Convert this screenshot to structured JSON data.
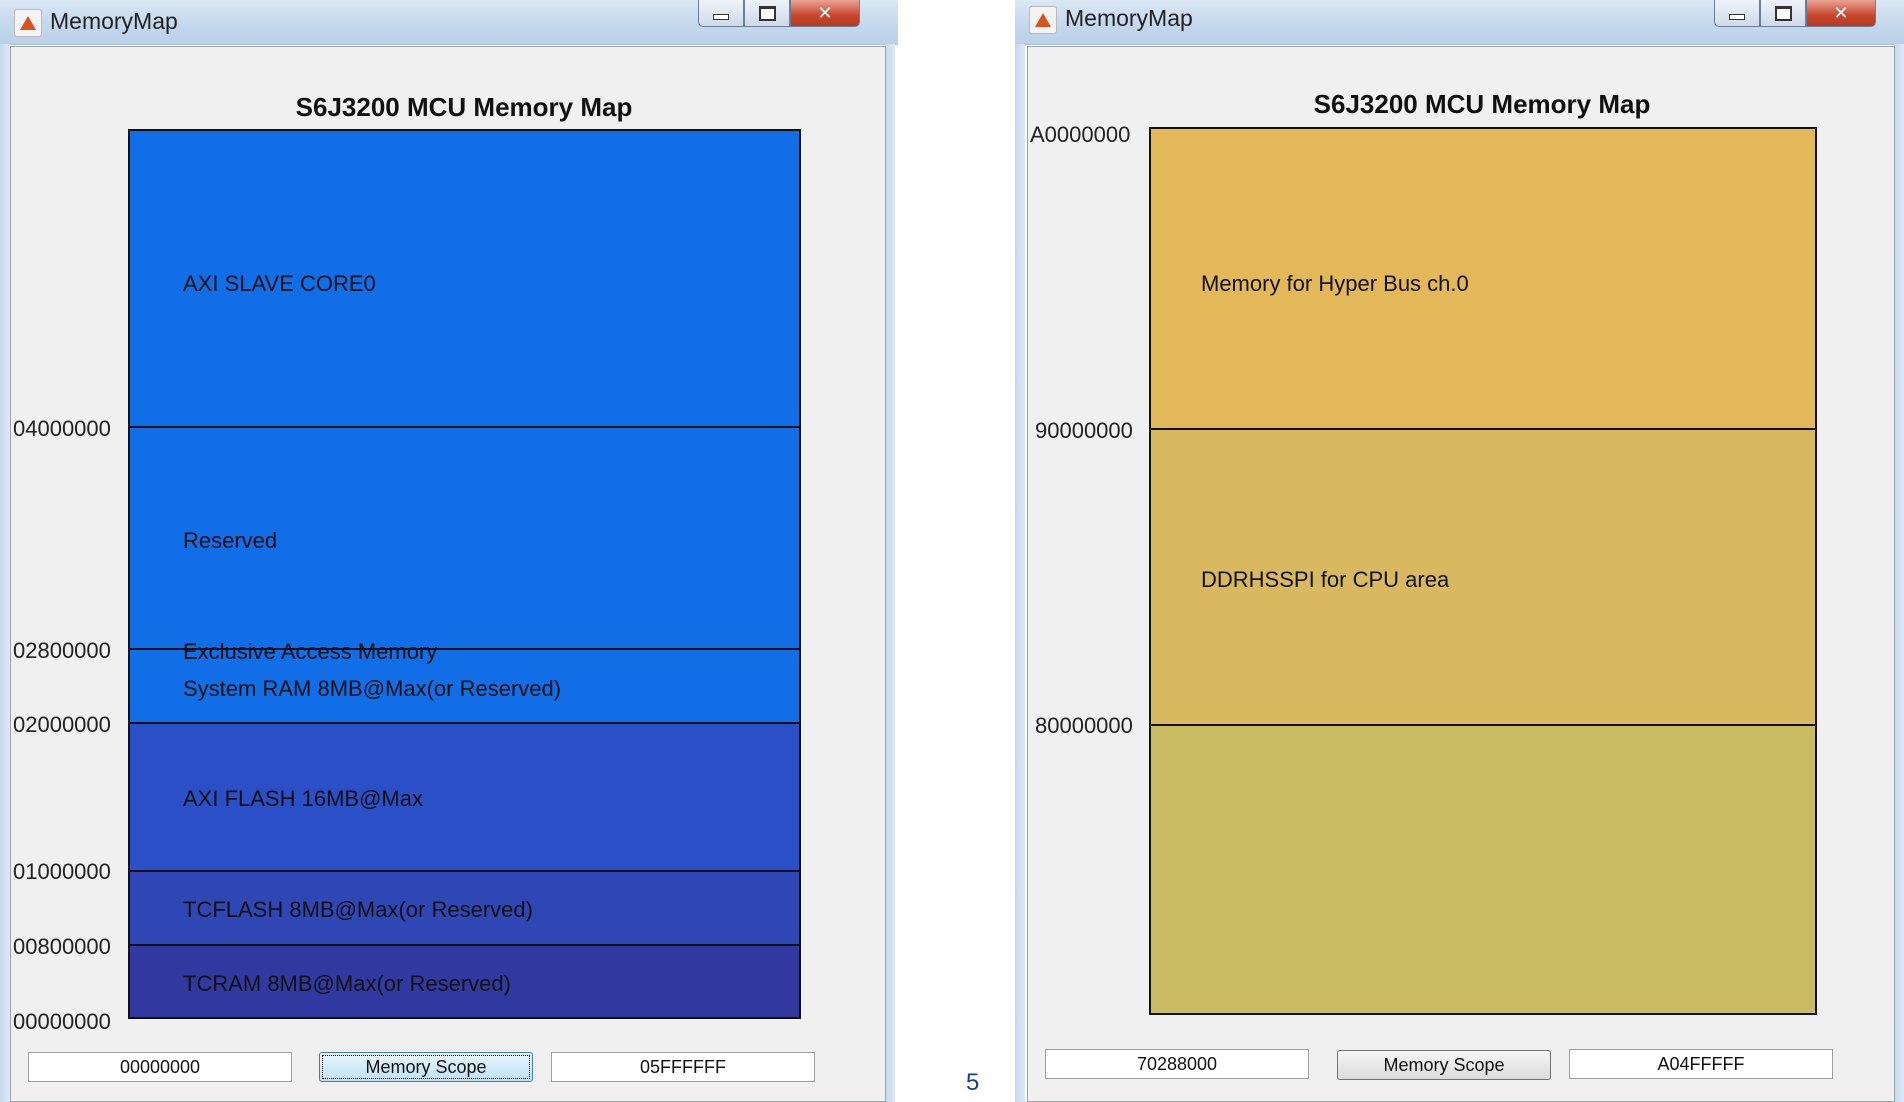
{
  "windows": {
    "left": {
      "title": "MemoryMap",
      "plot_title": "S6J3200 MCU Memory Map",
      "regions": [
        {
          "label": "AXI SLAVE CORE0",
          "color": "#126ee6"
        },
        {
          "label": "Reserved",
          "color": "#126ee6"
        },
        {
          "label": "Exclusive Access Memory",
          "color": "#126ee6"
        },
        {
          "label": "System RAM 8MB@Max(or Reserved)",
          "color": "#2b4fc6"
        },
        {
          "label": "AXI FLASH 16MB@Max",
          "color": "#2f46b5"
        },
        {
          "label": "TCFLASH 8MB@Max(or Reserved)",
          "color": "#31389f"
        },
        {
          "label": "TCRAM 8MB@Max(or Reserved)",
          "color": "#322f90"
        }
      ],
      "addresses": [
        "04000000",
        "02800000",
        "02000000",
        "01000000",
        "00800000",
        "00000000"
      ],
      "start_field": "00000000",
      "scope_button": "Memory Scope",
      "end_field": "05FFFFFF"
    },
    "right": {
      "title": "MemoryMap",
      "plot_title": "S6J3200 MCU Memory Map",
      "regions": [
        {
          "label": "Memory for Hyper Bus ch.0",
          "color": "#e2b859"
        },
        {
          "label": "DDRHSSPI for CPU area",
          "color": "#d8b95f"
        },
        {
          "label": "",
          "color": "#c9bb62"
        }
      ],
      "addresses": [
        "A0000000",
        "90000000",
        "80000000"
      ],
      "start_field": "70288000",
      "scope_button": "Memory Scope",
      "end_field": "A04FFFFF"
    }
  },
  "page_number": "5"
}
